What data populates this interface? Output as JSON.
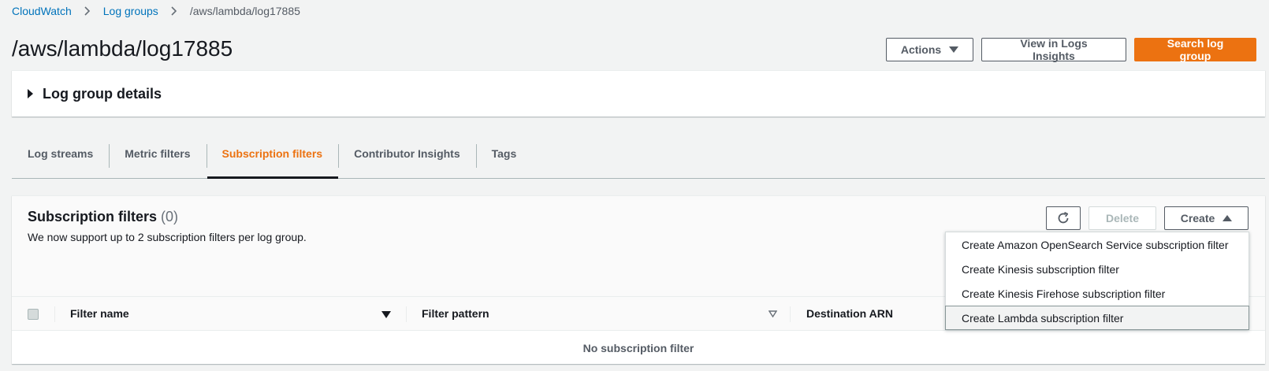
{
  "breadcrumb": {
    "items": [
      "CloudWatch",
      "Log groups"
    ],
    "current": "/aws/lambda/log17885"
  },
  "header": {
    "title": "/aws/lambda/log17885",
    "actions_label": "Actions",
    "logs_insights_label": "View in Logs Insights",
    "search_label": "Search log group"
  },
  "details": {
    "label": "Log group details"
  },
  "tabs": [
    {
      "label": "Log streams",
      "active": false
    },
    {
      "label": "Metric filters",
      "active": false
    },
    {
      "label": "Subscription filters",
      "active": true
    },
    {
      "label": "Contributor Insights",
      "active": false
    },
    {
      "label": "Tags",
      "active": false
    }
  ],
  "subscription": {
    "title": "Subscription filters",
    "count": "(0)",
    "description": "We now support up to 2 subscription filters per log group.",
    "delete_label": "Delete",
    "create_label": "Create"
  },
  "table": {
    "columns": [
      "Filter name",
      "Filter pattern",
      "Destination ARN"
    ],
    "empty": "No subscription filter"
  },
  "create_menu": {
    "items": [
      "Create Amazon OpenSearch Service subscription filter",
      "Create Kinesis subscription filter",
      "Create Kinesis Firehose subscription filter",
      "Create Lambda subscription filter"
    ],
    "highlighted": 3
  },
  "colors": {
    "link": "#0073bb",
    "accent": "#ec7211",
    "text": "#16191f"
  },
  "icons": [
    "chevron-right-icon",
    "caret-down-icon",
    "caret-up-icon",
    "refresh-icon",
    "caret-right-icon",
    "sort-down-icon"
  ]
}
